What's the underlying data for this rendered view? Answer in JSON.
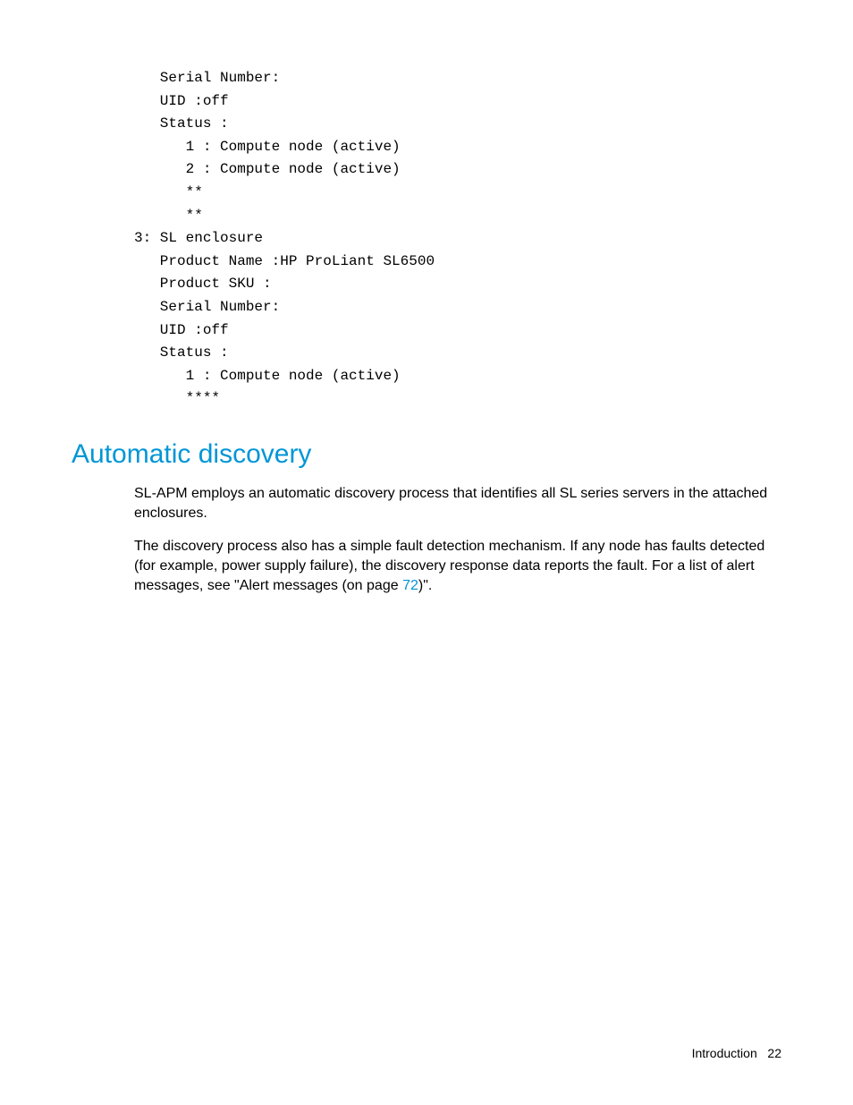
{
  "code": {
    "line1": "   Serial Number:",
    "line2": "   UID :off",
    "line3": "   Status :",
    "line4": "      1 : Compute node (active)",
    "line5": "      2 : Compute node (active)",
    "line6": "      **",
    "line7": "      **",
    "line8": "3: SL enclosure",
    "line9": "   Product Name :HP ProLiant SL6500",
    "line10": "   Product SKU :",
    "line11": "   Serial Number:",
    "line12": "   UID :off",
    "line13": "   Status :",
    "line14": "      1 : Compute node (active)",
    "line15": "      ****"
  },
  "heading": "Automatic discovery",
  "paragraph1": "SL-APM employs an automatic discovery process that identifies all SL series servers in the attached enclosures.",
  "paragraph2_part1": "The discovery process also has a simple fault detection mechanism. If any node has faults detected (for example, power supply failure), the discovery response data reports the fault. For a list of alert messages, see \"Alert messages (on page ",
  "paragraph2_link": "72",
  "paragraph2_part2": ")\".",
  "footer_section": "Introduction",
  "footer_page": "22"
}
